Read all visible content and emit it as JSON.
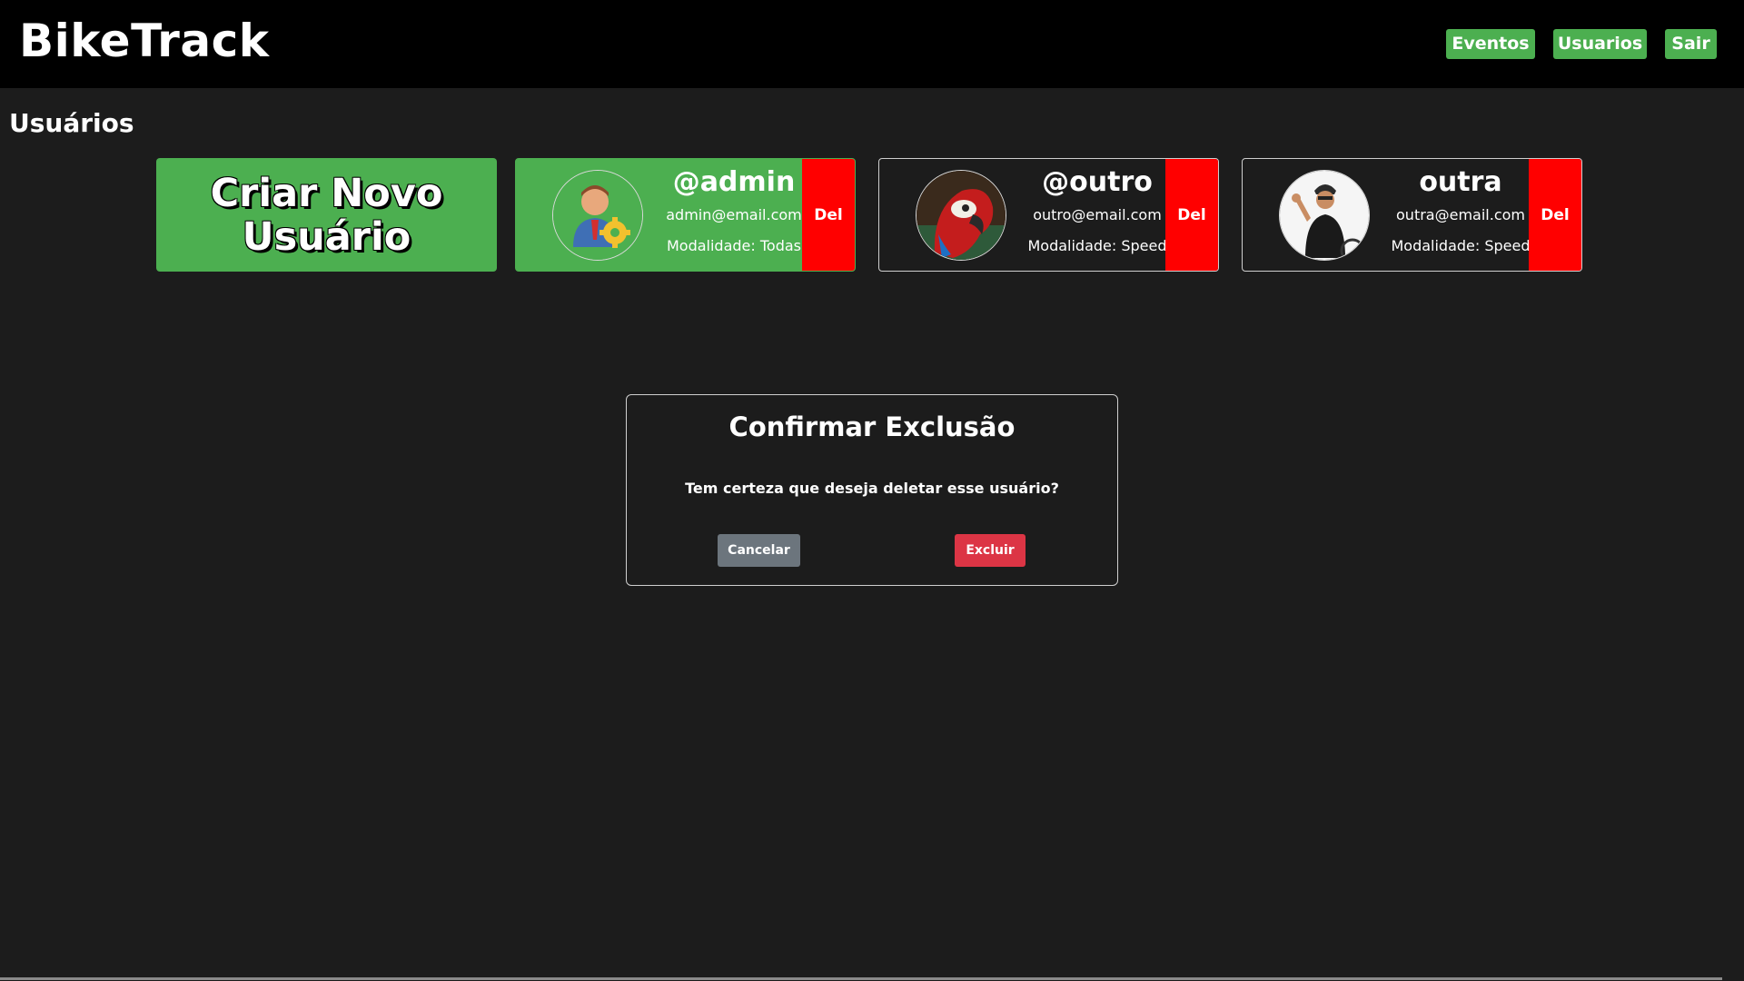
{
  "header": {
    "brand": "BikeTrack",
    "nav": [
      {
        "label": "Eventos"
      },
      {
        "label": "Usuarios"
      },
      {
        "label": "Sair"
      }
    ]
  },
  "page": {
    "title": "Usuários",
    "create_label": "Criar Novo Usuário"
  },
  "users": [
    {
      "username": "@admin",
      "email": "admin@email.com",
      "modalidade": "Modalidade: Todas",
      "avatar": "admin-gear-avatar",
      "del_label": "Del",
      "highlighted": true
    },
    {
      "username": "@outro",
      "email": "outro@email.com",
      "modalidade": "Modalidade: Speed",
      "avatar": "parrot-avatar",
      "del_label": "Del",
      "highlighted": false
    },
    {
      "username": "outra",
      "email": "outra@email.com",
      "modalidade": "Modalidade: Speed",
      "avatar": "cyclist-avatar",
      "del_label": "Del",
      "highlighted": false
    }
  ],
  "dialog": {
    "title": "Confirmar Exclusão",
    "message": "Tem certeza que deseja deletar esse usuário?",
    "cancel_label": "Cancelar",
    "confirm_label": "Excluir"
  },
  "colors": {
    "accent_green": "#4caf50",
    "delete_red": "#ff0000",
    "confirm_red": "#dc3545",
    "cancel_gray": "#6c757d",
    "background": "#1c1c1c"
  }
}
